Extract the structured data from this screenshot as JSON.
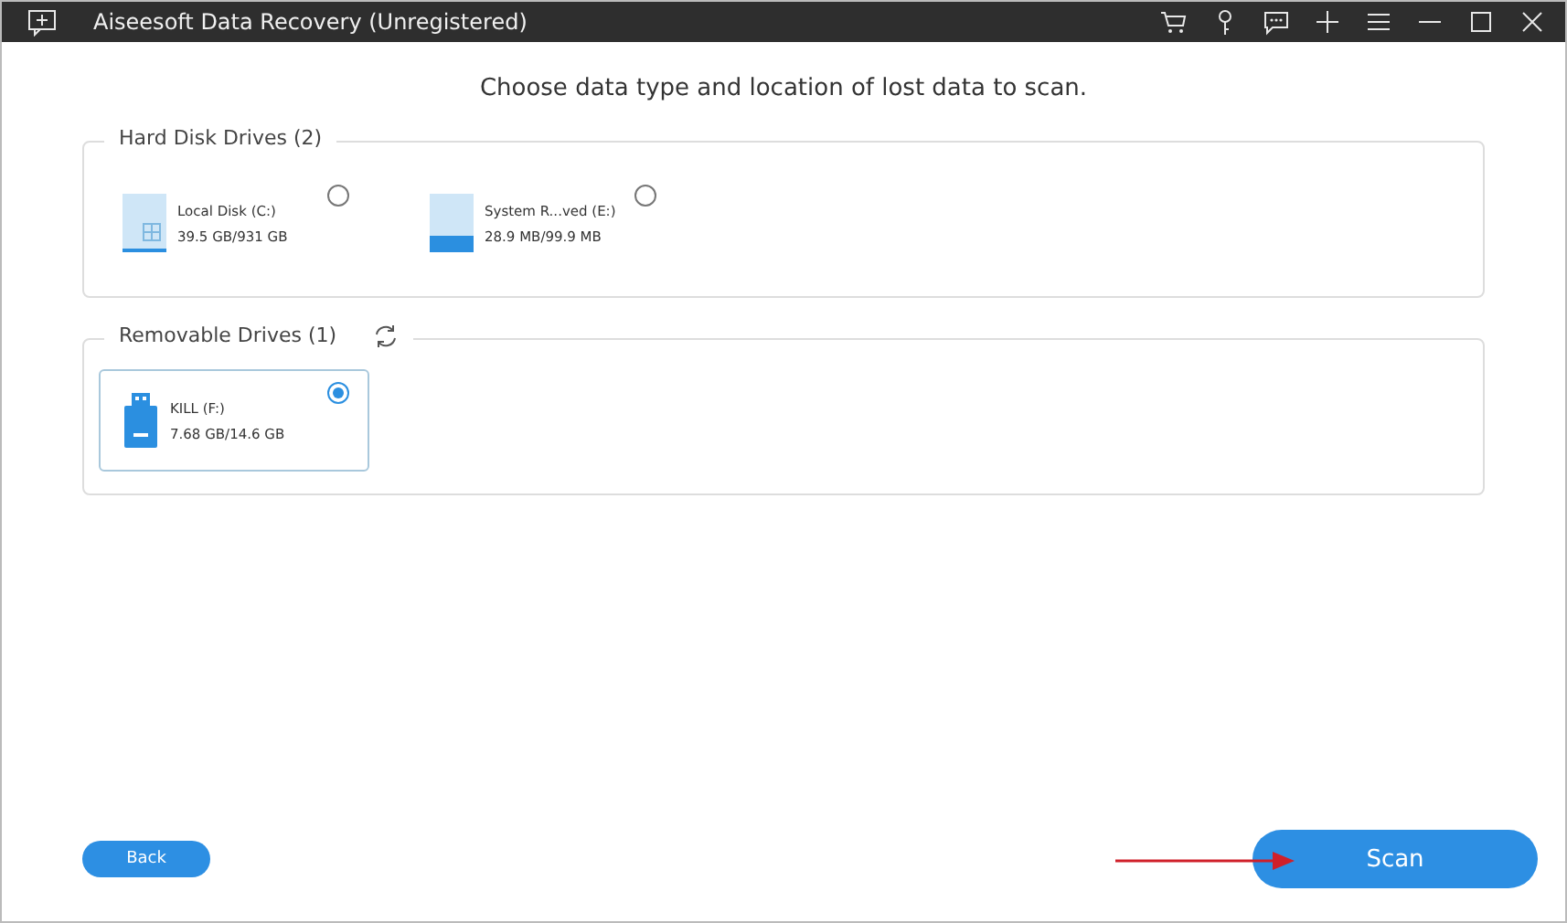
{
  "window": {
    "title": "Aiseesoft Data Recovery (Unregistered)"
  },
  "heading": "Choose data type and location of lost data to scan.",
  "groups": [
    {
      "title": "Hard Disk Drives (2)",
      "refresh": false,
      "drives": [
        {
          "kind": "system",
          "name": "Local Disk (C:)",
          "usage": "39.5 GB/931 GB",
          "level": 0.05,
          "selected": false
        },
        {
          "kind": "disk",
          "name": "System R...ved (E:)",
          "usage": "28.9 MB/99.9 MB",
          "level": 0.29,
          "selected": false
        }
      ]
    },
    {
      "title": "Removable Drives (1)",
      "refresh": true,
      "drives": [
        {
          "kind": "usb",
          "name": "KILL (F:)",
          "usage": "7.68 GB/14.6 GB",
          "selected": true
        }
      ]
    }
  ],
  "buttons": {
    "back": "Back",
    "scan": "Scan"
  }
}
